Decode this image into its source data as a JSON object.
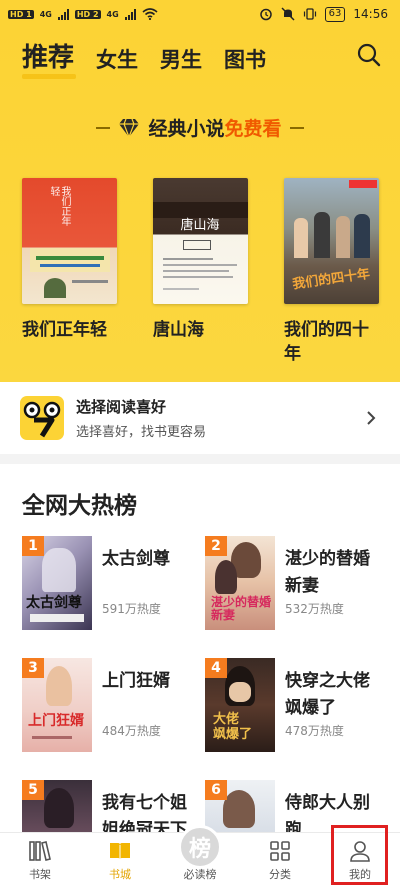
{
  "status_bar": {
    "sim1": "HD 1",
    "sim2": "HD 2",
    "net1": "4G",
    "net2": "4G",
    "battery": "63",
    "time": "14:56"
  },
  "nav": {
    "tabs": [
      {
        "label": "推荐",
        "active": true
      },
      {
        "label": "女生",
        "active": false
      },
      {
        "label": "男生",
        "active": false
      },
      {
        "label": "图书",
        "active": false
      }
    ]
  },
  "banner": {
    "part1": "经典小说",
    "part2": "免费看"
  },
  "featured_books": [
    {
      "title": "我们正年轻"
    },
    {
      "title": "唐山海"
    },
    {
      "title": "我们的四十年"
    }
  ],
  "preference": {
    "title": "选择阅读喜好",
    "subtitle": "选择喜好，找书更容易"
  },
  "ranking": {
    "title": "全网大热榜",
    "items": [
      {
        "rank": "1",
        "name": "太古剑尊",
        "heat": "591万热度"
      },
      {
        "rank": "2",
        "name": "湛少的替婚新妻",
        "heat": "532万热度"
      },
      {
        "rank": "3",
        "name": "上门狂婿",
        "heat": "484万热度"
      },
      {
        "rank": "4",
        "name": "快穿之大佬飒爆了",
        "heat": "478万热度"
      },
      {
        "rank": "5",
        "name": "我有七个姐姐绝冠天下",
        "heat": ""
      },
      {
        "rank": "6",
        "name": "侍郎大人别跑",
        "heat": ""
      }
    ]
  },
  "tab_bar": {
    "items": [
      {
        "label": "书架",
        "icon": "bookshelf-icon",
        "active": false
      },
      {
        "label": "书城",
        "icon": "bookstore-icon",
        "active": true
      },
      {
        "label": "必读榜",
        "icon": "must-read-icon",
        "active": false,
        "badge": "榜"
      },
      {
        "label": "分类",
        "icon": "category-icon",
        "active": false
      },
      {
        "label": "我的",
        "icon": "profile-icon",
        "active": false
      }
    ]
  },
  "colors": {
    "brand_yellow": "#fcd335",
    "accent_orange": "#f05a00",
    "rank_badge": "#f57c1f",
    "active_tab": "#e3a400",
    "highlight_red": "#e02020"
  }
}
